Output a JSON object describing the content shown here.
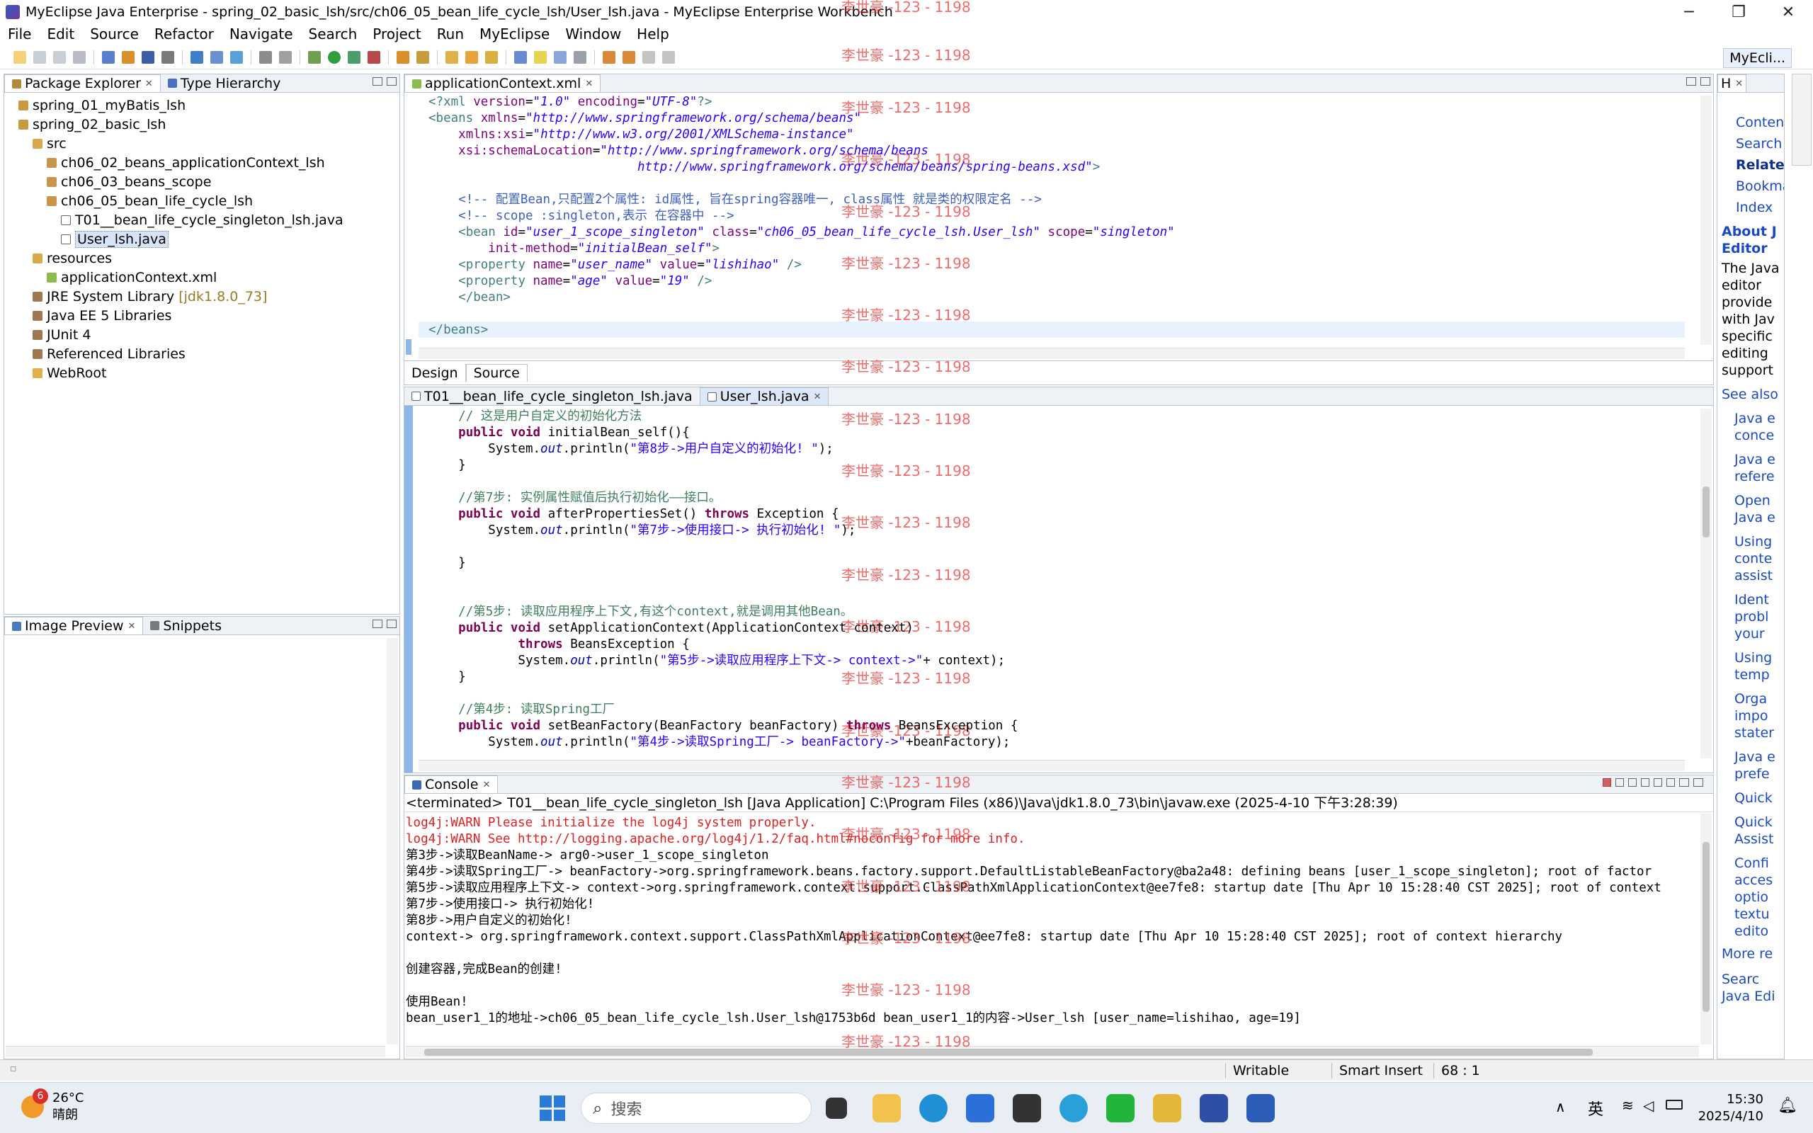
{
  "window": {
    "title": "MyEclipse Java Enterprise - spring_02_basic_lsh/src/ch06_05_bean_life_cycle_lsh/User_lsh.java - MyEclipse Enterprise Workbench",
    "minimize": "─",
    "maximize": "❐",
    "close": "✕"
  },
  "menu": [
    "File",
    "Edit",
    "Source",
    "Refactor",
    "Navigate",
    "Search",
    "Project",
    "Run",
    "MyEclipse",
    "Window",
    "Help"
  ],
  "perspective": "MyEcli...",
  "package_explorer": {
    "tab1": "Package Explorer",
    "tab2": "Type Hierarchy",
    "items": [
      {
        "label": "spring_01_myBatis_lsh",
        "decor": ""
      },
      {
        "label": "spring_02_basic_lsh",
        "decor": ""
      },
      {
        "label": "src",
        "decor": ""
      },
      {
        "label": "ch06_02_beans_applicationContext_lsh",
        "decor": ""
      },
      {
        "label": "ch06_03_beans_scope",
        "decor": ""
      },
      {
        "label": "ch06_05_bean_life_cycle_lsh",
        "decor": ""
      },
      {
        "label": "T01__bean_life_cycle_singleton_lsh.java",
        "decor": ""
      },
      {
        "label": "User_lsh.java",
        "decor": ""
      },
      {
        "label": "resources",
        "decor": ""
      },
      {
        "label": "applicationContext.xml",
        "decor": ""
      },
      {
        "label": "JRE System Library",
        "decor": "[jdk1.8.0_73]"
      },
      {
        "label": "Java EE 5 Libraries",
        "decor": ""
      },
      {
        "label": "JUnit 4",
        "decor": ""
      },
      {
        "label": "Referenced Libraries",
        "decor": ""
      },
      {
        "label": "WebRoot",
        "decor": ""
      }
    ]
  },
  "image_preview": {
    "tab1": "Image Preview",
    "tab2": "Snippets"
  },
  "xml_editor": {
    "tab": "applicationContext.xml",
    "bottom_tabs": [
      "Design",
      "Source"
    ],
    "lines": [
      [
        [
          "xml-tag",
          "<?xml "
        ],
        [
          "xml-attr",
          "version"
        ],
        [
          "",
          "="
        ],
        [
          "xml-val",
          "\"1.0\""
        ],
        [
          "xml-attr",
          " encoding"
        ],
        [
          "",
          "="
        ],
        [
          "xml-val",
          "\"UTF-8\""
        ],
        [
          "xml-tag",
          "?>"
        ]
      ],
      [
        [
          "xml-tag",
          "<beans "
        ],
        [
          "xml-attr",
          "xmlns"
        ],
        [
          "",
          "="
        ],
        [
          "xml-val",
          "\"http://www.springframework.org/schema/beans\""
        ]
      ],
      [
        [
          "",
          "    "
        ],
        [
          "xml-attr",
          "xmlns:xsi"
        ],
        [
          "",
          "="
        ],
        [
          "xml-val",
          "\"http://www.w3.org/2001/XMLSchema-instance\""
        ]
      ],
      [
        [
          "",
          "    "
        ],
        [
          "xml-attr",
          "xsi:schemaLocation"
        ],
        [
          "",
          "="
        ],
        [
          "xml-val",
          "\"http://www.springframework.org/schema/beans"
        ]
      ],
      [
        [
          "",
          "                            "
        ],
        [
          "xml-val",
          "http://www.springframework.org/schema/beans/spring-beans.xsd\""
        ],
        [
          "xml-tag",
          ">"
        ]
      ],
      [
        [
          "",
          ""
        ]
      ],
      [
        [
          "",
          "    "
        ],
        [
          "xml-comment",
          "<!-- 配置Bean,只配置2个属性: id属性, 旨在spring容器唯一, class属性 就是类的权限定名 -->"
        ]
      ],
      [
        [
          "",
          "    "
        ],
        [
          "xml-comment",
          "<!-- scope :singleton,表示 在容器中 -->"
        ]
      ],
      [
        [
          "",
          "    "
        ],
        [
          "xml-tag",
          "<bean "
        ],
        [
          "xml-attr",
          "id"
        ],
        [
          "",
          "="
        ],
        [
          "xml-val",
          "\"user_1_scope_singleton\""
        ],
        [
          "xml-attr",
          " class"
        ],
        [
          "",
          "="
        ],
        [
          "xml-val",
          "\"ch06_05_bean_life_cycle_lsh.User_lsh\""
        ],
        [
          "xml-attr",
          " scope"
        ],
        [
          "",
          "="
        ],
        [
          "xml-val",
          "\"singleton\""
        ]
      ],
      [
        [
          "",
          "        "
        ],
        [
          "xml-attr",
          "init-method"
        ],
        [
          "",
          "="
        ],
        [
          "xml-val",
          "\"initialBean_self\""
        ],
        [
          "xml-tag",
          ">"
        ]
      ],
      [
        [
          "",
          "    "
        ],
        [
          "xml-tag",
          "<property "
        ],
        [
          "xml-attr",
          "name"
        ],
        [
          "",
          "="
        ],
        [
          "xml-val",
          "\"user_name\""
        ],
        [
          "xml-attr",
          " value"
        ],
        [
          "",
          "="
        ],
        [
          "xml-val",
          "\"lishihao\""
        ],
        [
          "xml-tag",
          " />"
        ]
      ],
      [
        [
          "",
          "    "
        ],
        [
          "xml-tag",
          "<property "
        ],
        [
          "xml-attr",
          "name"
        ],
        [
          "",
          "="
        ],
        [
          "xml-val",
          "\"age\""
        ],
        [
          "xml-attr",
          " value"
        ],
        [
          "",
          "="
        ],
        [
          "xml-val",
          "\"19\""
        ],
        [
          "xml-tag",
          " />"
        ]
      ],
      [
        [
          "",
          "    "
        ],
        [
          "xml-tag",
          "</bean>"
        ]
      ],
      [
        [
          "",
          ""
        ]
      ],
      [
        [
          "xml-tag",
          "</beans>"
        ]
      ]
    ]
  },
  "java_editor": {
    "tabs": [
      "T01__bean_life_cycle_singleton_lsh.java",
      "User_lsh.java"
    ],
    "lines": [
      [
        [
          "",
          "    "
        ],
        [
          "java-comment",
          "// 这是用户自定义的初始化方法"
        ]
      ],
      [
        [
          "",
          "    "
        ],
        [
          "java-kw",
          "public void"
        ],
        [
          "",
          " initialBean_self(){"
        ]
      ],
      [
        [
          "",
          "        System."
        ],
        [
          "java-field",
          "out"
        ],
        [
          "",
          ".println("
        ],
        [
          "java-str",
          "\"第8步->用户自定义的初始化! \""
        ],
        [
          "",
          ");"
        ]
      ],
      [
        [
          "",
          "    }"
        ]
      ],
      [
        [
          "",
          ""
        ]
      ],
      [
        [
          "",
          "    "
        ],
        [
          "java-comment",
          "//第7步: 实例属性赋值后执行初始化——接口。"
        ]
      ],
      [
        [
          "",
          "    "
        ],
        [
          "java-kw",
          "public void"
        ],
        [
          "",
          " afterPropertiesSet() "
        ],
        [
          "java-kw",
          "throws"
        ],
        [
          "",
          " Exception {"
        ]
      ],
      [
        [
          "",
          "        System."
        ],
        [
          "java-field",
          "out"
        ],
        [
          "",
          ".println("
        ],
        [
          "java-str",
          "\"第7步->使用接口-> 执行初始化! \""
        ],
        [
          "",
          ");"
        ]
      ],
      [
        [
          "",
          ""
        ]
      ],
      [
        [
          "",
          "    }"
        ]
      ],
      [
        [
          "",
          ""
        ]
      ],
      [
        [
          "",
          ""
        ]
      ],
      [
        [
          "",
          "    "
        ],
        [
          "java-comment",
          "//第5步: 读取应用程序上下文,有这个context,就是调用其他Bean。"
        ]
      ],
      [
        [
          "",
          "    "
        ],
        [
          "java-kw",
          "public void"
        ],
        [
          "",
          " setApplicationContext(ApplicationContext context)"
        ]
      ],
      [
        [
          "",
          "            "
        ],
        [
          "java-kw",
          "throws"
        ],
        [
          "",
          " BeansException {"
        ]
      ],
      [
        [
          "",
          "            System."
        ],
        [
          "java-field",
          "out"
        ],
        [
          "",
          ".println("
        ],
        [
          "java-str",
          "\"第5步->读取应用程序上下文-> context->\""
        ],
        [
          "",
          "+ context);"
        ]
      ],
      [
        [
          "",
          "    }"
        ]
      ],
      [
        [
          "",
          ""
        ]
      ],
      [
        [
          "",
          "    "
        ],
        [
          "java-comment",
          "//第4步: 读取Spring工厂"
        ]
      ],
      [
        [
          "",
          "    "
        ],
        [
          "java-kw",
          "public void"
        ],
        [
          "",
          " setBeanFactory(BeanFactory beanFactory) "
        ],
        [
          "java-kw",
          "throws"
        ],
        [
          "",
          " BeansException {"
        ]
      ],
      [
        [
          "",
          "        System."
        ],
        [
          "java-field",
          "out"
        ],
        [
          "",
          ".println("
        ],
        [
          "java-str",
          "\"第4步->读取Spring工厂-> beanFactory->\""
        ],
        [
          "",
          "+beanFactory);"
        ]
      ]
    ]
  },
  "console": {
    "tab": "Console",
    "header": "<terminated> T01__bean_life_cycle_singleton_lsh [Java Application] C:\\Program Files (x86)\\Java\\jdk1.8.0_73\\bin\\javaw.exe (2025-4-10 下午3:28:39)",
    "lines": [
      {
        "t": "log4j:WARN Please initialize the log4j system properly.",
        "err": true
      },
      {
        "t": "log4j:WARN See http://logging.apache.org/log4j/1.2/faq.html#noconfig for more info.",
        "err": true
      },
      {
        "t": "第3步->读取BeanName-> arg0->user_1_scope_singleton",
        "err": false
      },
      {
        "t": "第4步->读取Spring工厂-> beanFactory->org.springframework.beans.factory.support.DefaultListableBeanFactory@ba2a48: defining beans [user_1_scope_singleton]; root of factor",
        "err": false
      },
      {
        "t": "第5步->读取应用程序上下文-> context->org.springframework.context.support.ClassPathXmlApplicationContext@ee7fe8: startup date [Thu Apr 10 15:28:40 CST 2025]; root of context",
        "err": false
      },
      {
        "t": "第7步->使用接口-> 执行初始化!",
        "err": false
      },
      {
        "t": "第8步->用户自定义的初始化!",
        "err": false
      },
      {
        "t": "context-> org.springframework.context.support.ClassPathXmlApplicationContext@ee7fe8: startup date [Thu Apr 10 15:28:40 CST 2025]; root of context hierarchy",
        "err": false
      },
      {
        "t": "",
        "err": false
      },
      {
        "t": "创建容器,完成Bean的创建!",
        "err": false
      },
      {
        "t": "",
        "err": false
      },
      {
        "t": "使用Bean!",
        "err": false
      },
      {
        "t": "bean_user1_1的地址->ch06_05_bean_life_cycle_lsh.User_lsh@1753b6d bean_user1_1的内容->User_lsh [user_name=lishihao, age=19]",
        "err": false
      }
    ]
  },
  "help": {
    "tab": "H",
    "links_top": [
      "Content",
      "Search",
      "Related",
      "Bookma",
      "Index"
    ],
    "heading": "About J Editor",
    "body": "The Java editor provide with Jav specific editing support",
    "see_also": "See also",
    "links": [
      "Java e conce",
      "Java e refere",
      "Open Java e",
      "Using conte assist",
      "Ident probl your",
      "Using temp",
      "Orga impo stater",
      "Java e prefe",
      "Quick",
      "Quick Assist",
      "Confi acces optio textu edito"
    ],
    "more": "More re",
    "search_footer": "Searc Java Edi"
  },
  "status": {
    "writable": "Writable",
    "insert": "Smart Insert",
    "position": "68 : 1"
  },
  "watermark": "李世豪 -123 - 1198",
  "taskbar": {
    "temp": "26°C",
    "weather": "晴朗",
    "badge": "6",
    "search": "搜索",
    "ime": "英",
    "time": "15:30",
    "date": "2025/4/10"
  }
}
